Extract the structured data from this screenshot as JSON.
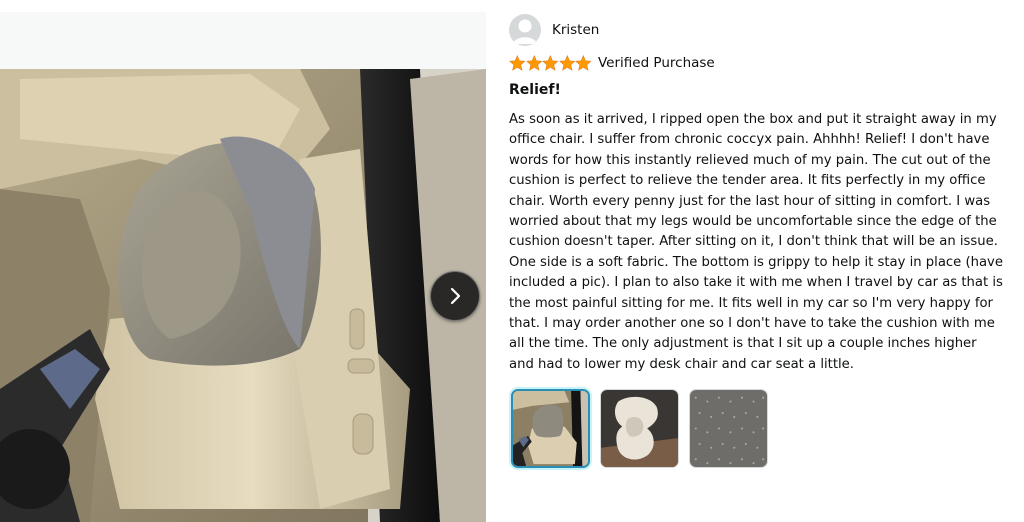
{
  "reviewer": {
    "name": "Kristen",
    "avatar_icon": "user-silhouette-icon"
  },
  "rating": {
    "stars": 5,
    "max": 5,
    "star_color": "#ff9900",
    "verified_label": "Verified Purchase"
  },
  "review": {
    "title": "Relief!",
    "body": "As soon as it arrived, I ripped open the box and put it straight away in my office chair. I suffer from chronic coccyx pain. Ahhhh! Relief! I don't have words for how this instantly relieved much of my pain. The cut out of the cushion is perfect to relieve the tender area. It fits perfectly in my office chair. Worth every penny just for the last hour of sitting in comfort. I was worried about that my legs would be uncomfortable since the edge of the cushion doesn't taper. After sitting on it, I don't think that will be an issue. One side is a soft fabric. The bottom is grippy to help it stay in place (have included a pic). I plan to also take it with me when I travel by car as that is the most painful sitting for me. It fits well in my car so I'm very happy for that. I may order another one so I don't have to take the cushion with me all the time. The only adjustment is that I sit up a couple inches higher and had to lower my desk chair and car seat a little."
  },
  "media": {
    "next_icon": "chevron-right-icon",
    "active_index": 0,
    "thumbnails": [
      {
        "name": "thumbnail-cushion-in-car-seat"
      },
      {
        "name": "thumbnail-cushion-top-view"
      },
      {
        "name": "thumbnail-grippy-bottom-fabric"
      }
    ],
    "selected_border_color": "#2a8fb3"
  }
}
